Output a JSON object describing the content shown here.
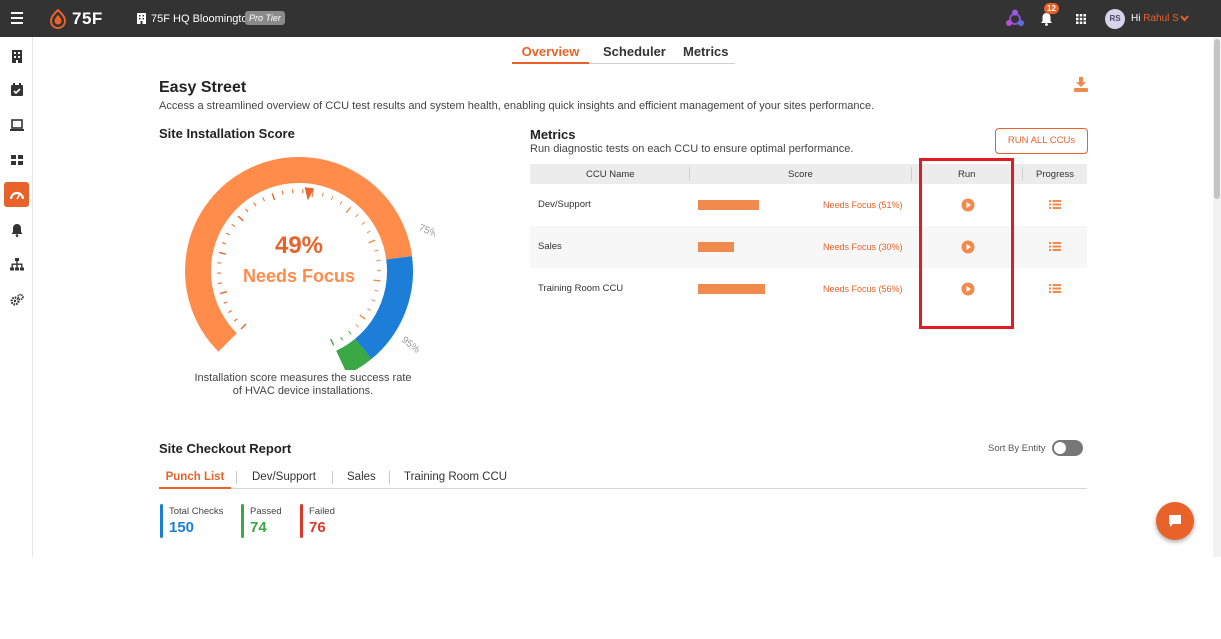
{
  "colors": {
    "accent": "#e8622a",
    "topbar": "#333333",
    "blue": "#1c7ed6",
    "green": "#3aa845",
    "red": "#d83a2a",
    "highlight": "#e31b23"
  },
  "topbar": {
    "brand": "75F",
    "site": "75F HQ Bloomington",
    "tier": "Pro Tier",
    "notifications": "12",
    "avatar_initials": "RS",
    "greeting": "Hi",
    "user": "Rahul S"
  },
  "sidebar": {
    "items": [
      {
        "icon": "building-icon"
      },
      {
        "icon": "calendar-check-icon"
      },
      {
        "icon": "laptop-icon"
      },
      {
        "icon": "dashboard-grid-icon"
      },
      {
        "icon": "gauge-icon",
        "active": true
      },
      {
        "icon": "bell-icon"
      },
      {
        "icon": "hierarchy-icon"
      },
      {
        "icon": "gears-icon"
      }
    ]
  },
  "tabs": [
    "Overview",
    "Scheduler",
    "Metrics"
  ],
  "page": {
    "title": "Easy Street",
    "description": "Access a streamlined overview of CCU test results and system health, enabling quick insights and efficient management of your sites performance."
  },
  "score": {
    "title": "Site Installation Score",
    "value": 49,
    "value_text": "49%",
    "status": "Needs Focus",
    "mark_75": "75%",
    "mark_95": "95%",
    "caption_line1": "Installation score measures the success rate",
    "caption_line2": "of HVAC device installations."
  },
  "metrics": {
    "title": "Metrics",
    "description": "Run diagnostic tests on each CCU to ensure optimal performance.",
    "run_all": "RUN ALL CCUs",
    "columns": [
      "CCU Name",
      "Score",
      "Run",
      "Progress"
    ],
    "rows": [
      {
        "name": "Dev/Support",
        "status": "Needs Focus (51%)",
        "score": 51
      },
      {
        "name": "Sales",
        "status": "Needs Focus (30%)",
        "score": 30
      },
      {
        "name": "Training Room CCU",
        "status": "Needs Focus (56%)",
        "score": 56
      }
    ]
  },
  "checkout": {
    "title": "Site Checkout Report",
    "sort_label": "Sort By Entity",
    "sort_enabled": false,
    "tabs": [
      "Punch List",
      "Dev/Support",
      "Sales",
      "Training Room CCU"
    ],
    "stats": [
      {
        "label": "Total Checks",
        "value": "150"
      },
      {
        "label": "Passed",
        "value": "74"
      },
      {
        "label": "Failed",
        "value": "76"
      }
    ]
  }
}
